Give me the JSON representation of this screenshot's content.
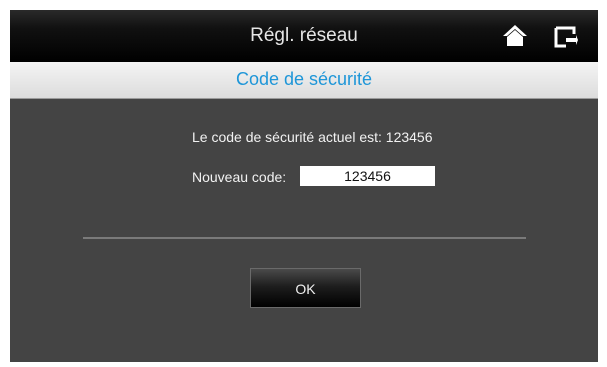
{
  "header": {
    "title": "Régl. réseau",
    "home_icon": "home-icon",
    "back_icon": "back-icon"
  },
  "section": {
    "title": "Code de sécurité"
  },
  "form": {
    "current_code_text": "Le code de sécurité actuel est: 123456",
    "new_code_label": "Nouveau code:",
    "new_code_value": "123456",
    "ok_label": "OK"
  },
  "colors": {
    "title_text": "#e6e6e6",
    "subtitle_text": "#1e96d8",
    "panel_bg": "#444444"
  }
}
